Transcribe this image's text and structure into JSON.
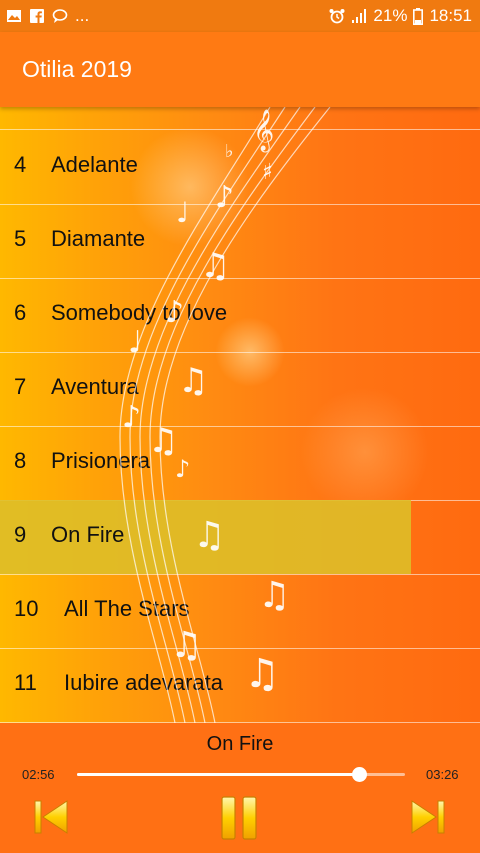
{
  "status_bar": {
    "left_icons": [
      "gallery-icon",
      "facebook-icon",
      "chat-icon"
    ],
    "overflow": "...",
    "battery_percent": "21%",
    "time": "18:51"
  },
  "app": {
    "title": "Otilia 2019"
  },
  "playlist": [
    {
      "num": "4",
      "title": "Adelante",
      "selected": false
    },
    {
      "num": "5",
      "title": "Diamante",
      "selected": false
    },
    {
      "num": "6",
      "title": "Somebody to love",
      "selected": false
    },
    {
      "num": "7",
      "title": "Aventura",
      "selected": false
    },
    {
      "num": "8",
      "title": "Prisionera",
      "selected": false
    },
    {
      "num": "9",
      "title": "On Fire",
      "selected": true
    },
    {
      "num": "10",
      "title": "All The Stars",
      "selected": false
    },
    {
      "num": "11",
      "title": "Iubire adevarata",
      "selected": false
    }
  ],
  "player": {
    "now_playing": "On Fire",
    "elapsed": "02:56",
    "duration": "03:26",
    "progress": 0.86
  },
  "colors": {
    "accent": "#ff7a13",
    "selected_row": "#debe28",
    "control_gold": "#ffd000"
  }
}
